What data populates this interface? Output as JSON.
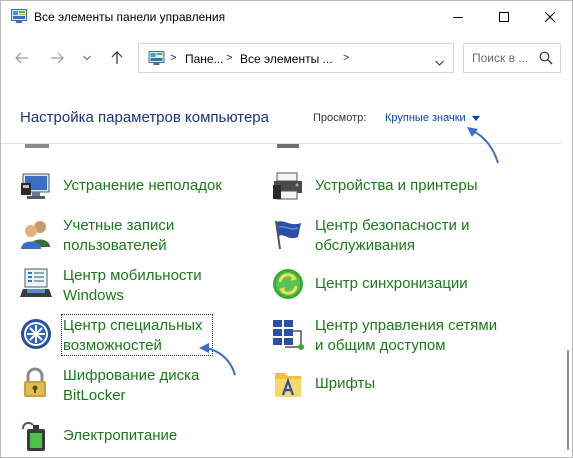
{
  "window": {
    "title": "Все элементы панели управления"
  },
  "nav": {
    "breadcrumbs": [
      "Пане...",
      "Все элементы ..."
    ],
    "search_placeholder": "Поиск в ..."
  },
  "content": {
    "title": "Настройка параметров компьютера",
    "view_label": "Просмотр:",
    "view_value": "Крупные значки"
  },
  "items": [
    {
      "line1": "Устранение неполадок",
      "line2": "",
      "icon": "troubleshooting-icon"
    },
    {
      "line1": "Устройства и принтеры",
      "line2": "",
      "icon": "devices-printers-icon"
    },
    {
      "line1": "Учетные записи",
      "line2": "пользователей",
      "icon": "user-accounts-icon"
    },
    {
      "line1": "Центр безопасности и",
      "line2": "обслуживания",
      "icon": "security-flag-icon"
    },
    {
      "line1": "Центр мобильности",
      "line2": "Windows",
      "icon": "mobility-center-icon"
    },
    {
      "line1": "Центр синхронизации",
      "line2": "",
      "icon": "sync-center-icon"
    },
    {
      "line1": "Центр специальных",
      "line2": "возможностей",
      "icon": "accessibility-icon"
    },
    {
      "line1": "Центр управления сетями",
      "line2": "и общим доступом",
      "icon": "network-center-icon"
    },
    {
      "line1": "Шифрование диска",
      "line2": "BitLocker",
      "icon": "bitlocker-icon"
    },
    {
      "line1": "Шрифты",
      "line2": "",
      "icon": "fonts-icon"
    },
    {
      "line1": "Электропитание",
      "line2": "",
      "icon": "power-options-icon"
    }
  ],
  "colors": {
    "title_blue": "#1e3287",
    "link_green": "#1a7a1a",
    "link_blue": "#0046c8",
    "annotation_arrow": "#3b6fc4"
  }
}
